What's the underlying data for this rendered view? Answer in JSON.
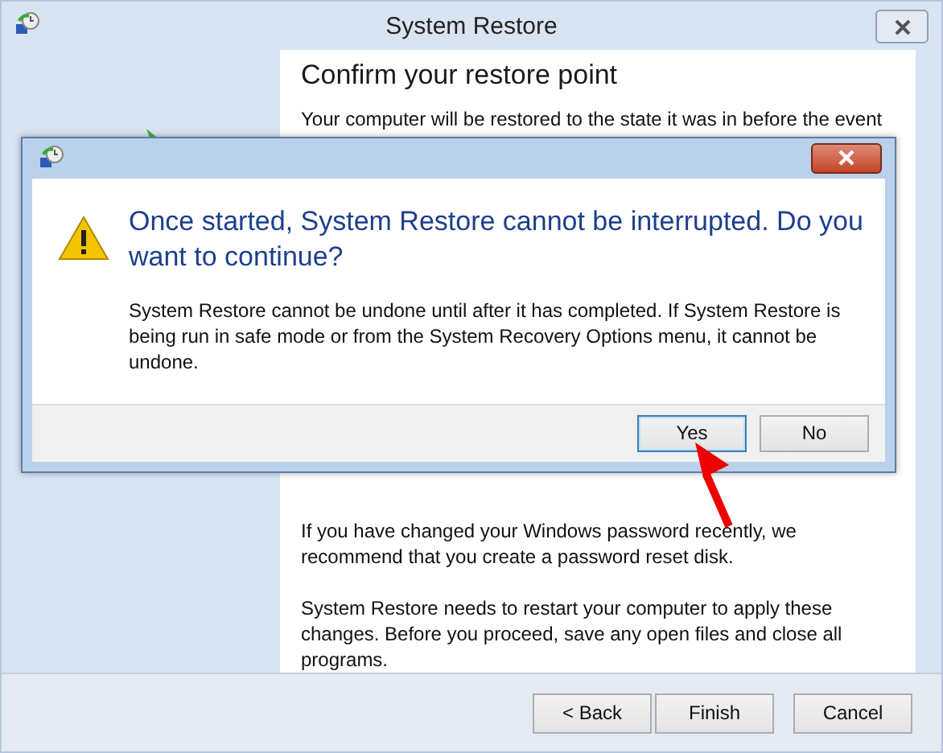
{
  "window": {
    "title": "System Restore"
  },
  "page": {
    "heading": "Confirm your restore point",
    "intro": "Your computer will be restored to the state it was in before the event",
    "password_note": "If you have changed your Windows password recently, we recommend that you create a password reset disk.",
    "restart_note": "System Restore needs to restart your computer to apply these changes. Before you proceed, save any open files and close all programs."
  },
  "buttons": [
    {
      "label": "< Back"
    },
    {
      "label": "Finish"
    },
    {
      "label": "Cancel"
    }
  ],
  "dialog": {
    "instruction": "Once started, System Restore cannot be interrupted. Do you want to continue?",
    "message": "System Restore cannot be undone until after it has completed. If System Restore is being run in safe mode or from the System Recovery Options menu, it cannot be undone.",
    "buttons": [
      {
        "label": "Yes",
        "selected": true
      },
      {
        "label": "No",
        "selected": false
      }
    ]
  }
}
